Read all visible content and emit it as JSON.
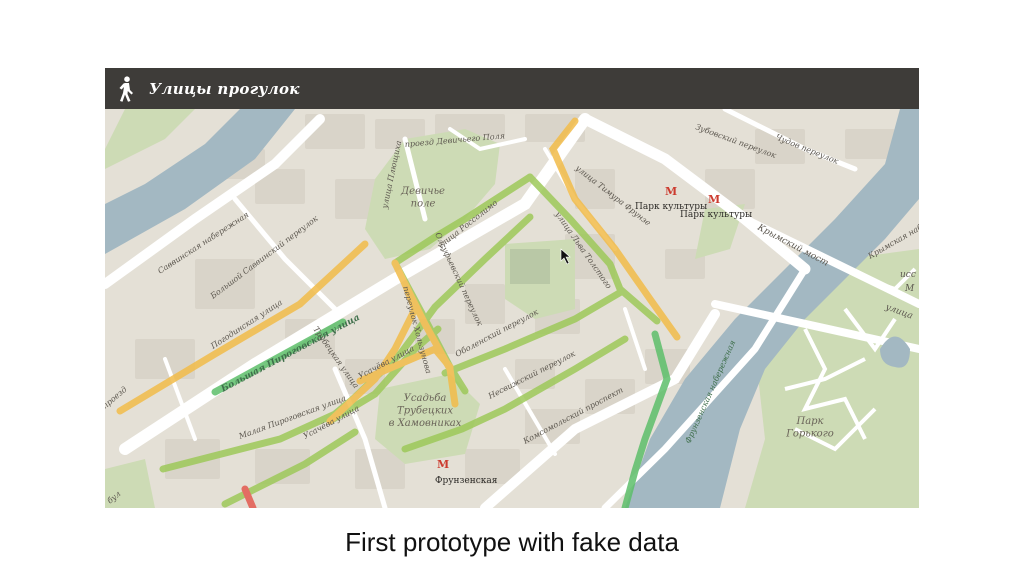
{
  "app": {
    "title": "Улицы прогулок",
    "icon": "pedestrian-icon"
  },
  "caption": "First prototype with fake data",
  "colors": {
    "header_bg": "#3e3c39",
    "river": "#a3b8c2",
    "park": "#cddbb5",
    "land": "#e4e0d6",
    "road": "#ffffff",
    "walk_good": "#5dbf6a",
    "walk_ok": "#9ec95a",
    "walk_medium": "#f2bc4a",
    "walk_bad": "#e35a4f",
    "metro": "#cc3b2f"
  },
  "map": {
    "areas": {
      "field": "Девичье\nполе",
      "estate": "Усадьба\nТрубецких\nв Хамовниках",
      "park": "Парк\nГорького"
    },
    "metro": {
      "park": "Парк культуры",
      "park2": "Парк культуры",
      "frunze": "Фрунзенская"
    },
    "streets": {
      "savvinskaya": "Саввинская набережная",
      "b_savvinsky": "Большой Саввинский переулок",
      "pogodinskaya": "Погодинская улица",
      "b_pirogovskaya": "Большая Пироговская улица",
      "m_pirogovskaya": "Малая Пироговская улица",
      "trubetskaya": "Трубецкая улица",
      "usachyova": "Усачёва улица",
      "usachyova2": "Усачёва улица",
      "rossolimo": "улица Россолимо",
      "olsufyevsky": "Олсуфьевский переулок",
      "khokhlova": "переулок Хользунова",
      "obolensky": "Оболенский переулок",
      "lva_tolstogo": "улица Льва Толстого",
      "timura": "улица Тимура Фрунзе",
      "neskuchny": "Несвижский переулок",
      "komsomolsky": "Комсомольский проспект",
      "frunzenskaya_nab": "Фрунзенская набережная",
      "krymsky": "Крымский мост",
      "devichye": "проезд Девичьего Поля",
      "plyushchikha": "улица Плющиха",
      "krymskaya_nab": "Крымская набережная",
      "ulitsa": "улица",
      "isc": "исс",
      "m": "М",
      "pr": "проезд",
      "zubovsky": "Зубовский переулок",
      "chudov": "Чудов переулок",
      "ksh": "бул"
    }
  }
}
